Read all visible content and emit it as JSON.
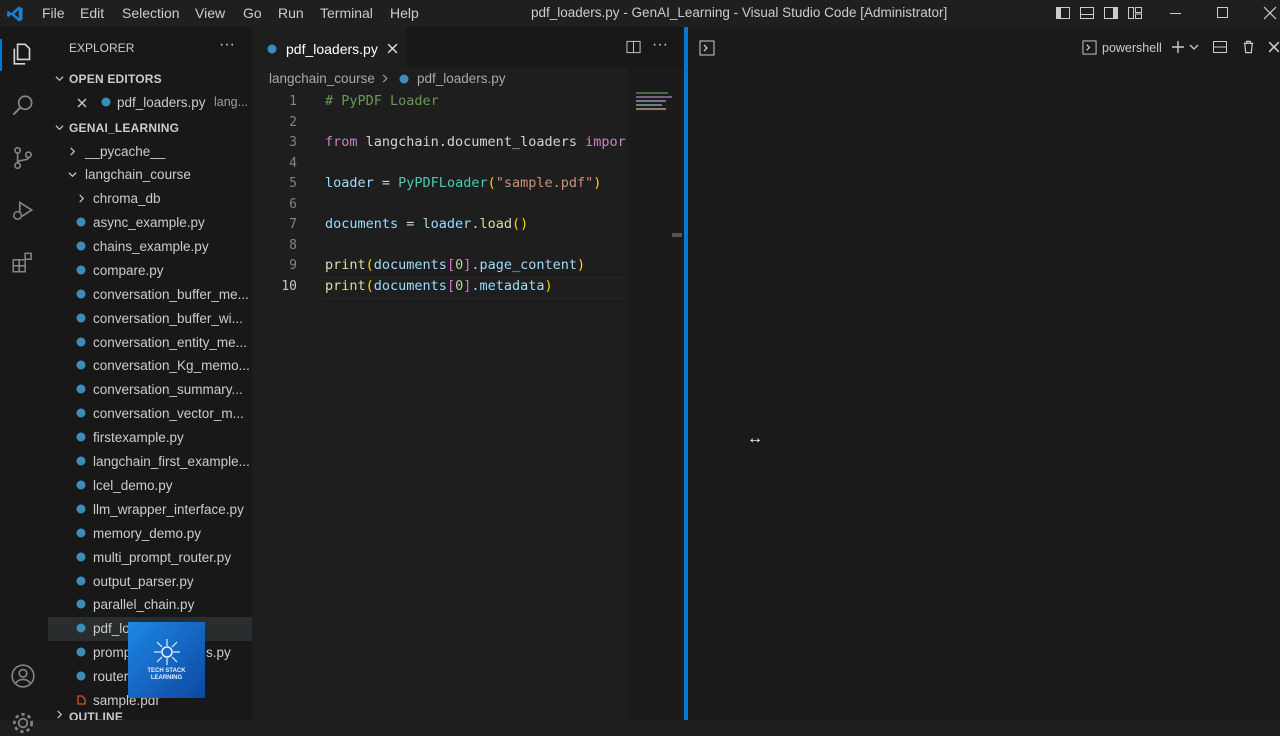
{
  "menu": [
    "File",
    "Edit",
    "Selection",
    "View",
    "Go",
    "Run",
    "Terminal",
    "Help"
  ],
  "window_title": "pdf_loaders.py - GenAI_Learning - Visual Studio Code [Administrator]",
  "sidebar": {
    "header": "EXPLORER",
    "open_editors_label": "OPEN EDITORS",
    "open_editor": {
      "name": "pdf_loaders.py",
      "path": "lang..."
    },
    "workspace_label": "GENAI_LEARNING",
    "folders": {
      "pycache": "__pycache__",
      "langchain_course": "langchain_course",
      "chroma_db": "chroma_db"
    },
    "files": [
      "async_example.py",
      "chains_example.py",
      "compare.py",
      "conversation_buffer_me...",
      "conversation_buffer_wi...",
      "conversation_entity_me...",
      "conversation_Kg_memo...",
      "conversation_summary...",
      "conversation_vector_m...",
      "firstexample.py",
      "langchain_first_example...",
      "lcel_demo.py",
      "llm_wrapper_interface.py",
      "memory_demo.py",
      "multi_prompt_router.py",
      "output_parser.py",
      "parallel_chain.py",
      "pdf_lo",
      "promp",
      "router",
      "sample.pdf"
    ],
    "prompt_suffix": "s.py",
    "outline_label": "OUTLINE",
    "watermark": "TECH STACK LEARNING"
  },
  "editor": {
    "tab_label": "pdf_loaders.py",
    "breadcrumb": {
      "folder": "langchain_course",
      "file": "pdf_loaders.py"
    },
    "line_numbers": [
      "1",
      "2",
      "3",
      "4",
      "5",
      "6",
      "7",
      "8",
      "9",
      "10"
    ],
    "lines": {
      "l1": "# PyPDF Loader",
      "l3_kw1": "from",
      "l3_mod": " langchain.document_loaders ",
      "l3_kw2": "impor",
      "l5_var": "loader",
      "l5_eq": " = ",
      "l5_cls": "PyPDFLoader",
      "l5_p1": "(",
      "l5_str": "\"sample.pdf\"",
      "l5_p2": ")",
      "l7_var": "documents",
      "l7_eq": " = ",
      "l7_obj": "loader",
      "l7_dot": ".",
      "l7_fn": "load",
      "l7_p": "()",
      "l9_fn": "print",
      "l9_p1": "(",
      "l9_var": "documents",
      "l9_b1": "[",
      "l9_num": "0",
      "l9_b2": "]",
      "l9_attr": ".page_content",
      "l9_p2": ")",
      "l10_fn": "print",
      "l10_p1": "(",
      "l10_var": "documents",
      "l10_b1": "[",
      "l10_num": "0",
      "l10_b2": "]",
      "l10_attr": ".metadata",
      "l10_p2": ")"
    }
  },
  "terminal": {
    "shell_label": "powershell",
    "cursor_glyph": "↔"
  },
  "colors": {
    "accent": "#0078d4",
    "python_icon": "#3c8dbc",
    "pdf_icon": "#e44d26"
  }
}
